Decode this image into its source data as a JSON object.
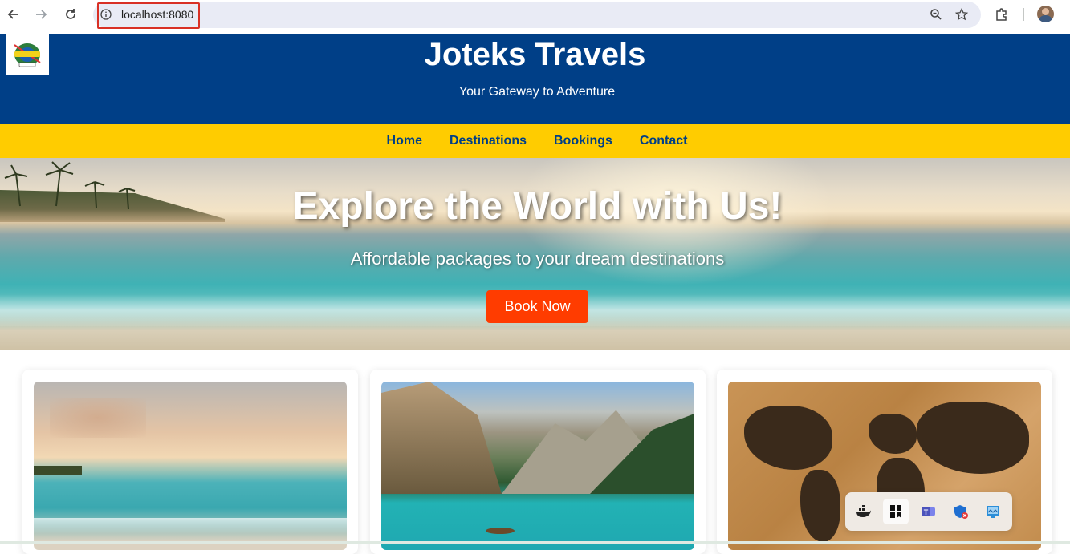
{
  "browser": {
    "url": "localhost:8080"
  },
  "header": {
    "title": "Joteks Travels",
    "tagline": "Your Gateway to Adventure"
  },
  "nav": {
    "items": [
      {
        "label": "Home"
      },
      {
        "label": "Destinations"
      },
      {
        "label": "Bookings"
      },
      {
        "label": "Contact"
      }
    ]
  },
  "hero": {
    "title": "Explore the World with Us!",
    "subtitle": "Affordable packages to your dream destinations",
    "cta": "Book Now"
  },
  "colors": {
    "header_bg": "#003f87",
    "nav_bg": "#ffcc00",
    "nav_text": "#003f87",
    "cta_bg": "#ff3c00"
  },
  "tray": {
    "icons": [
      "docker-icon",
      "app-grid-icon",
      "teams-icon",
      "security-icon",
      "network-icon"
    ]
  }
}
